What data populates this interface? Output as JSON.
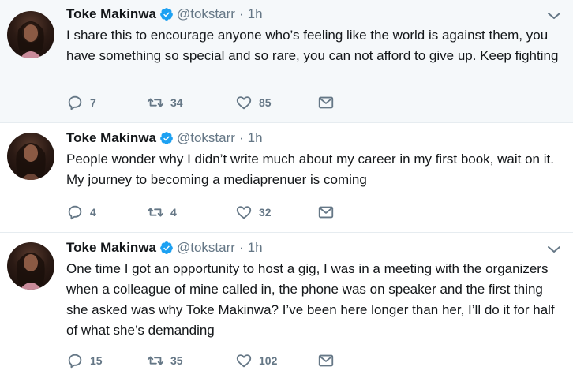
{
  "colors": {
    "text": "#14171a",
    "secondary": "#657786",
    "verified": "#1da1f2",
    "highlight_bg": "#f5f8fa",
    "divider": "#e6ecf0"
  },
  "tweets": [
    {
      "name": "Toke Makinwa",
      "handle": "@tokstarr",
      "time": "1h",
      "text": "I share this to encourage anyone who’s feeling like the world is against them, you have something so special and so rare, you can not afford to give up. Keep fighting",
      "replies": "7",
      "retweets": "34",
      "likes": "85"
    },
    {
      "name": "Toke Makinwa",
      "handle": "@tokstarr",
      "time": "1h",
      "text": "People wonder why I didn’t write much about my career in my first book, wait on it. My journey to becoming a mediaprenuer is coming",
      "replies": "4",
      "retweets": "4",
      "likes": "32"
    },
    {
      "name": "Toke Makinwa",
      "handle": "@tokstarr",
      "time": "1h",
      "text": "One time I got an opportunity to host a gig, I was in a meeting with the organizers when a colleague of mine called in, the phone was on speaker and the first thing she asked was why Toke Makinwa? I’ve been here longer than her, I’ll do it for half of what she’s demanding",
      "replies": "15",
      "retweets": "35",
      "likes": "102"
    }
  ],
  "separator": "·",
  "icons": {
    "reply": "reply-icon",
    "retweet": "retweet-icon",
    "like": "heart-icon",
    "dm": "envelope-icon",
    "verified": "verified-badge-icon",
    "more": "chevron-down-icon"
  }
}
